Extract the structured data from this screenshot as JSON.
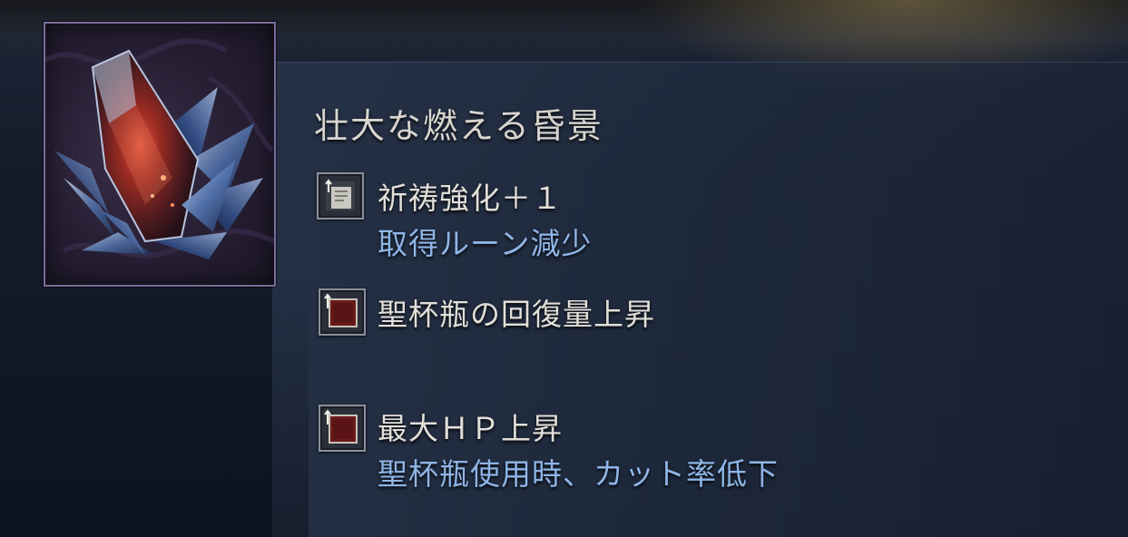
{
  "relic": {
    "name": "壮大な燃える昏景",
    "icon": "red-crystal-relic-icon",
    "frame_color": "#7b6c9a"
  },
  "effects": [
    {
      "icon": "scroll-upgrade-icon",
      "main": "祈祷強化＋１",
      "sub": "取得ルーン減少"
    },
    {
      "icon": "red-stat-upgrade-icon",
      "main": "聖杯瓶の回復量上昇",
      "sub": ""
    },
    {
      "icon": "red-stat-upgrade-icon",
      "main": "最大ＨＰ上昇",
      "sub": "聖杯瓶使用時、カット率低下"
    }
  ],
  "colors": {
    "effect_main": "#e2dfd9",
    "effect_sub": "#8fb5e6",
    "title": "#d8d5cf"
  }
}
